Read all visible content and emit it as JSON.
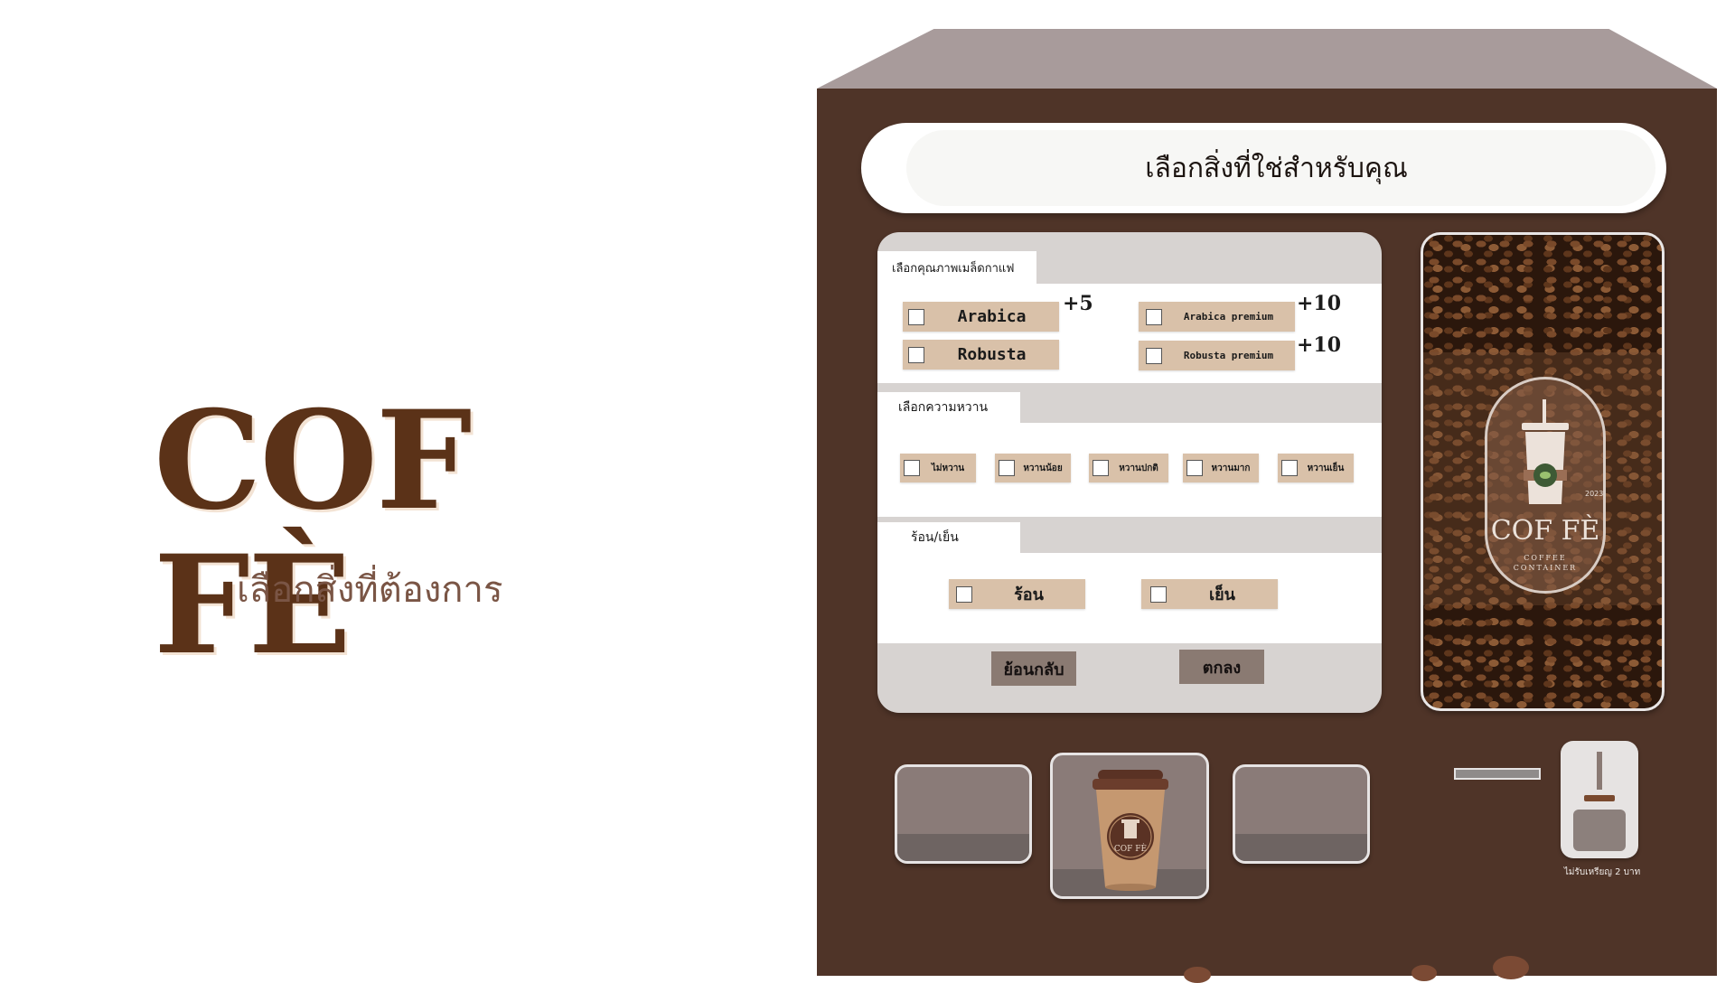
{
  "brand": {
    "title": "COF FÈ",
    "subtitle": "เลือกสิ่งที่ต้องการ"
  },
  "machine": {
    "header": "เลือกสิ่งที่ใช่สำหรับคุณ",
    "bean_section": {
      "tab_label": "เลือกคุณภาพเมล็ดกาแฟ",
      "options": [
        {
          "label": "Arabica",
          "price": "+5",
          "checked": false
        },
        {
          "label": "Robusta",
          "price": "",
          "checked": false
        },
        {
          "label": "Arabica premium",
          "price": "+10",
          "checked": false
        },
        {
          "label": "Robusta premium",
          "price": "+10",
          "checked": false
        }
      ]
    },
    "sweetness_section": {
      "tab_label": "เลือกความหวาน",
      "options": [
        {
          "label": "ไม่หวาน",
          "checked": false
        },
        {
          "label": "หวานน้อย",
          "checked": false
        },
        {
          "label": "หวานปกติ",
          "checked": false
        },
        {
          "label": "หวานมาก",
          "checked": false
        },
        {
          "label": "หวานเย็น",
          "checked": false
        }
      ]
    },
    "temperature_section": {
      "tab_label": "ร้อน/เย็น",
      "options": [
        {
          "label": "ร้อน",
          "checked": false
        },
        {
          "label": "เย็น",
          "checked": false
        }
      ]
    },
    "buttons": {
      "back": "ย้อนกลับ",
      "confirm": "ตกลง"
    },
    "emblem": {
      "title": "COF FÈ",
      "subtitle_line1": "COFFEE",
      "subtitle_line2": "CONTAINER",
      "year": "2023"
    },
    "cup_logo_text": "COF FÈ",
    "coin_note": "ไม่รับเหรียญ 2 บาท"
  },
  "colors": {
    "machine_body": "#4f3428",
    "roof": "#a89b9b",
    "option_bg": "#d9c1a9",
    "button_bg": "#8a7a72",
    "brand": "#5b3218"
  }
}
